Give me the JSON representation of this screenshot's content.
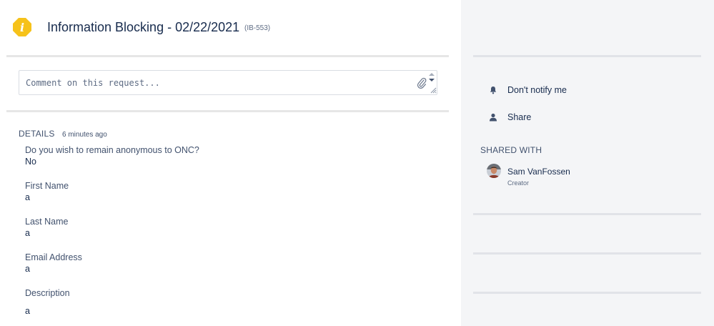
{
  "request": {
    "title": "Information Blocking - 02/22/2021",
    "key": "(IB-553)",
    "icon": "info-icon",
    "icon_color": "#f6c21a"
  },
  "comment": {
    "placeholder": "Comment on this request..."
  },
  "details": {
    "label": "DETAILS",
    "time": "6 minutes ago",
    "fields": [
      {
        "label": "Do you wish to remain anonymous to ONC?",
        "value": "No"
      },
      {
        "label": "First Name",
        "value": "a"
      },
      {
        "label": "Last Name",
        "value": "a"
      },
      {
        "label": "Email Address",
        "value": "a"
      },
      {
        "label": "Description",
        "value": "a"
      }
    ]
  },
  "sidebar": {
    "actions": [
      {
        "label": "Don't notify me",
        "icon": "bell-icon"
      },
      {
        "label": "Share",
        "icon": "person-icon"
      }
    ],
    "shared_with": {
      "label": "SHARED WITH",
      "people": [
        {
          "name": "Sam VanFossen",
          "role": "Creator"
        }
      ]
    }
  },
  "colors": {
    "sidebar_bg": "#f4f5f7",
    "text": "#172b4d",
    "muted": "#42526e"
  }
}
